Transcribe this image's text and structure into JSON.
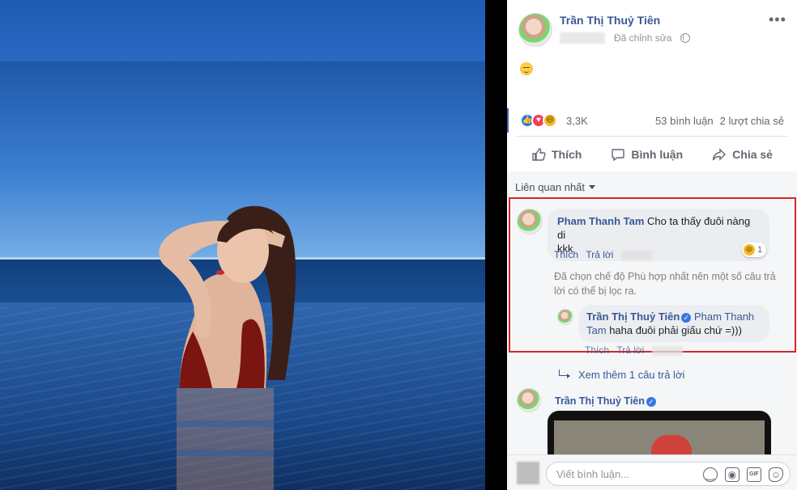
{
  "post": {
    "author": "Trần Thị Thuỷ Tiên",
    "edited": "Đã chỉnh sửa",
    "reactions_count": "3,3K",
    "comments_count": "53 bình luận",
    "shares_count": "2 lượt chia sẻ",
    "actions": {
      "like": "Thích",
      "comment": "Bình luận",
      "share": "Chia sẻ"
    }
  },
  "comments": {
    "sort_label": "Liên quan nhất",
    "first": {
      "name": "Pham Thanh Tam",
      "text_line1": "Cho ta thấy đuôi nàng di",
      "text_line2": "kkk",
      "reaction_count": "1",
      "like": "Thích",
      "reply": "Trả lời"
    },
    "filter_note_line1": "Đã chọn chế độ Phù hợp nhất nên một số câu trả",
    "filter_note_line2": "lời có thể bị lọc ra.",
    "reply": {
      "name": "Trần Thị Thuỷ Tiên",
      "mention_part1": "Pham Thanh",
      "mention_part2": "Tam",
      "text": "haha đuôi phải giấu chứ =)))",
      "like": "Thích",
      "reply": "Trả lời"
    },
    "more_replies": "Xem thêm 1 câu trả lời",
    "second": {
      "name": "Trần Thị Thuỷ Tiên"
    },
    "composer_placeholder": "Viết bình luận..."
  },
  "colors": {
    "link": "#385898",
    "highlight_border": "#d6262b",
    "like_blue": "#2078f4",
    "love_red": "#f33e58",
    "haha_yellow": "#f7b928"
  },
  "icons": [
    "globe-icon",
    "more-options-icon",
    "like-icon",
    "comment-icon",
    "share-icon",
    "verified-badge-icon",
    "reply-arrow-icon",
    "emoji-icon",
    "camera-icon",
    "gif-icon",
    "sticker-icon"
  ]
}
